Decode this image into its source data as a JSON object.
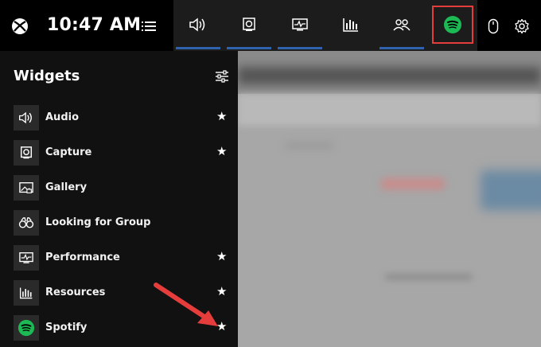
{
  "topbar": {
    "clock": "10:47 AM",
    "logo_icon": "xbox-icon",
    "menu_icon": "list-icon",
    "widget_buttons": [
      {
        "name": "audio",
        "icon": "speaker-icon",
        "active": true
      },
      {
        "name": "capture",
        "icon": "capture-icon",
        "active": true
      },
      {
        "name": "performance",
        "icon": "performance-icon",
        "active": true
      },
      {
        "name": "resources",
        "icon": "resources-icon",
        "active": false
      },
      {
        "name": "looking-for-group",
        "icon": "people-icon",
        "active": true
      },
      {
        "name": "spotify",
        "icon": "spotify-icon",
        "active": false
      }
    ],
    "mouse_icon": "mouse-icon",
    "settings_icon": "gear-icon"
  },
  "panel": {
    "title": "Widgets",
    "items": [
      {
        "label": "Audio",
        "icon": "speaker-icon",
        "favorite": true
      },
      {
        "label": "Capture",
        "icon": "capture-icon",
        "favorite": true
      },
      {
        "label": "Gallery",
        "icon": "gallery-icon",
        "favorite": false
      },
      {
        "label": "Looking for Group",
        "icon": "binoculars-icon",
        "favorite": false
      },
      {
        "label": "Performance",
        "icon": "performance-icon",
        "favorite": true
      },
      {
        "label": "Resources",
        "icon": "resources-icon",
        "favorite": true
      },
      {
        "label": "Spotify",
        "icon": "spotify-icon",
        "favorite": true
      }
    ],
    "star_glyph": "★"
  },
  "colors": {
    "accent_bar": "#2f63ad",
    "spotify_green": "#1db954",
    "highlight_red": "#e53c3c",
    "arrow_red": "#e53c3c"
  }
}
